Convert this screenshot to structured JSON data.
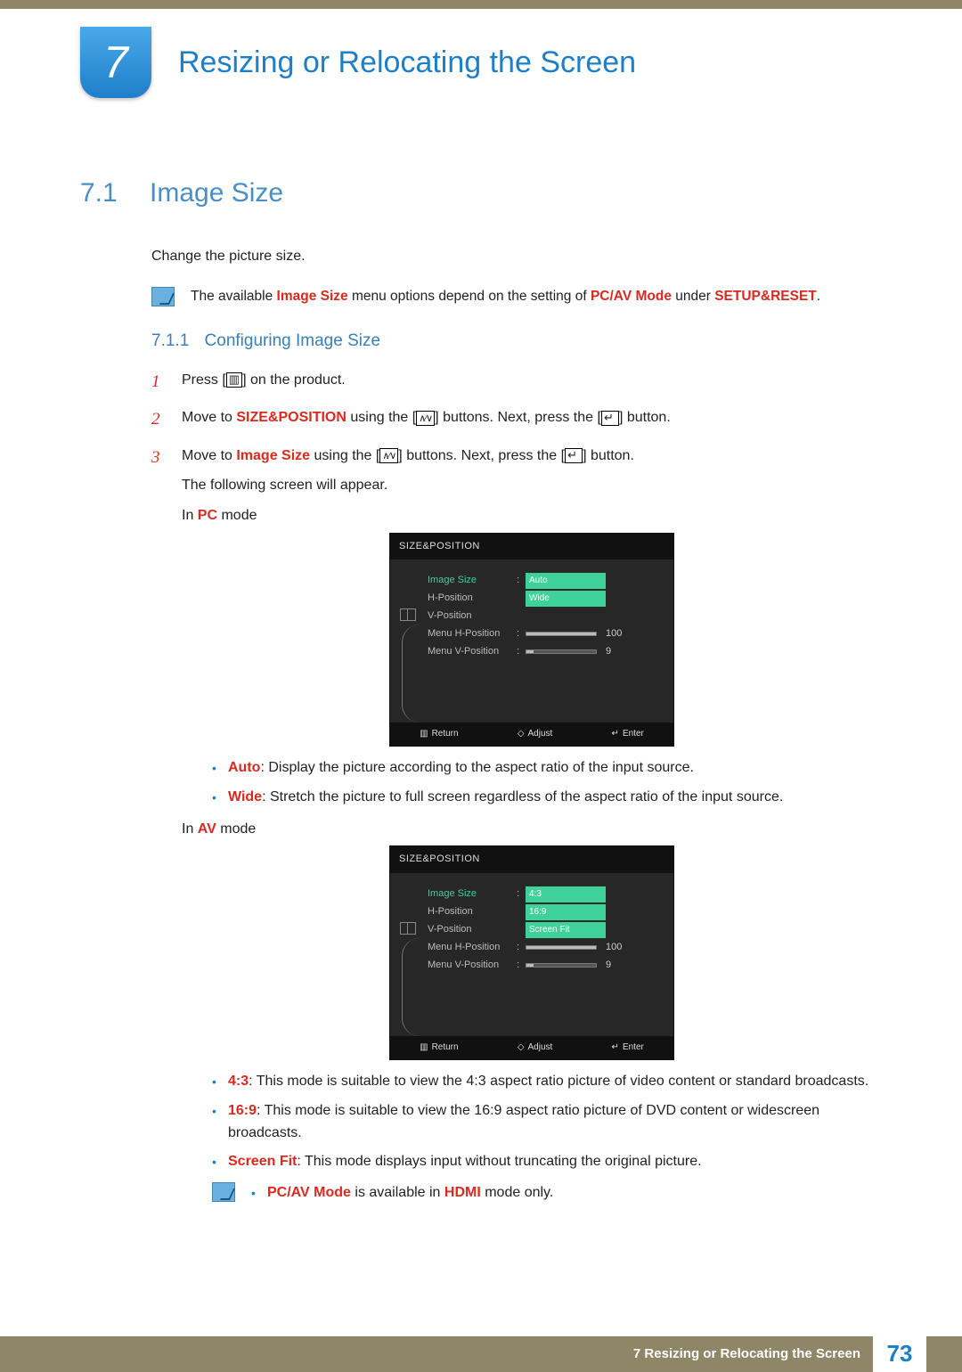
{
  "chapter": {
    "number": "7",
    "title": "Resizing or Relocating the Screen"
  },
  "section": {
    "number": "7.1",
    "title": "Image Size",
    "intro": "Change the picture size."
  },
  "note1": {
    "pre": "The available ",
    "red1": "Image Size",
    "mid": " menu options depend on the setting of ",
    "red2": "PC/AV Mode",
    "mid2": " under ",
    "red3": "SETUP&RESET",
    "post": "."
  },
  "subsection": {
    "number": "7.1.1",
    "title": "Configuring Image Size"
  },
  "steps": {
    "s1": {
      "num": "1",
      "a": "Press [",
      "b": "] on the product."
    },
    "s2": {
      "num": "2",
      "a": "Move to ",
      "red": "SIZE&POSITION",
      "b": " using the [",
      "c": "] buttons. Next, press the [",
      "d": "] button."
    },
    "s3": {
      "num": "3",
      "a": "Move to ",
      "red": "Image Size",
      "b": " using the [",
      "c": "] buttons. Next, press the [",
      "d": "] button.",
      "appear": "The following screen will appear.",
      "inPcPre": "In ",
      "inPcRed": "PC",
      "inPcPost": " mode",
      "inAvPre": "In ",
      "inAvRed": "AV",
      "inAvPost": " mode"
    }
  },
  "osd_common": {
    "title": "SIZE&POSITION",
    "rows": {
      "r1": "Image Size",
      "r2": "H-Position",
      "r3": "V-Position",
      "r4": "Menu H-Position",
      "r5": "Menu V-Position"
    },
    "v100": "100",
    "v9": "9",
    "footer": {
      "ret": "Return",
      "adj": "Adjust",
      "ent": "Enter"
    }
  },
  "osd1": {
    "opt1": "Auto",
    "opt2": "Wide"
  },
  "osd2": {
    "opt1": "4:3",
    "opt2": "16:9",
    "opt3": "Screen Fit"
  },
  "bullets_pc": {
    "b1": {
      "red": "Auto",
      "txt": ": Display the picture according to the aspect ratio of the input source."
    },
    "b2": {
      "red": "Wide",
      "txt": ": Stretch the picture to full screen regardless of the aspect ratio of the input source."
    }
  },
  "bullets_av": {
    "b1": {
      "red": "4:3",
      "txt": ": This mode is suitable to view the 4:3 aspect ratio picture of video content or standard broadcasts."
    },
    "b2": {
      "red": "16:9",
      "txt": ": This mode is suitable to view the 16:9 aspect ratio picture of DVD content or widescreen broadcasts."
    },
    "b3": {
      "red": "Screen Fit",
      "txt": ": This mode displays input without truncating the original picture."
    }
  },
  "note2": {
    "red1": "PC/AV Mode",
    "mid": " is available in ",
    "red2": "HDMI",
    "post": " mode only."
  },
  "footer": {
    "chapter": "7 Resizing or Relocating the Screen",
    "page": "73"
  }
}
